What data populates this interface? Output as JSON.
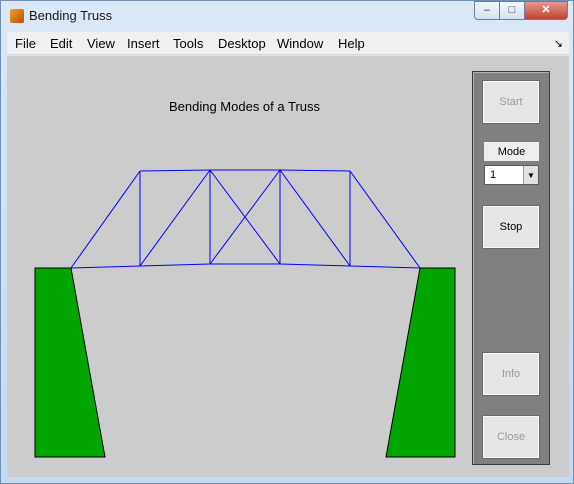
{
  "window": {
    "title": "Bending Truss",
    "minimize_glyph": "–",
    "maximize_glyph": "□",
    "close_glyph": "✕"
  },
  "menu": {
    "items": [
      "File",
      "Edit",
      "View",
      "Insert",
      "Tools",
      "Desktop",
      "Window",
      "Help"
    ],
    "dock_glyph": "↘"
  },
  "figure": {
    "title": "Bending Modes of a Truss",
    "truss_color": "#0000ff",
    "support_color": "#00a500"
  },
  "controls": {
    "start_label": "Start",
    "mode_label": "Mode",
    "mode_value": "1",
    "mode_arrow": "▼",
    "stop_label": "Stop",
    "info_label": "Info",
    "close_label": "Close"
  }
}
